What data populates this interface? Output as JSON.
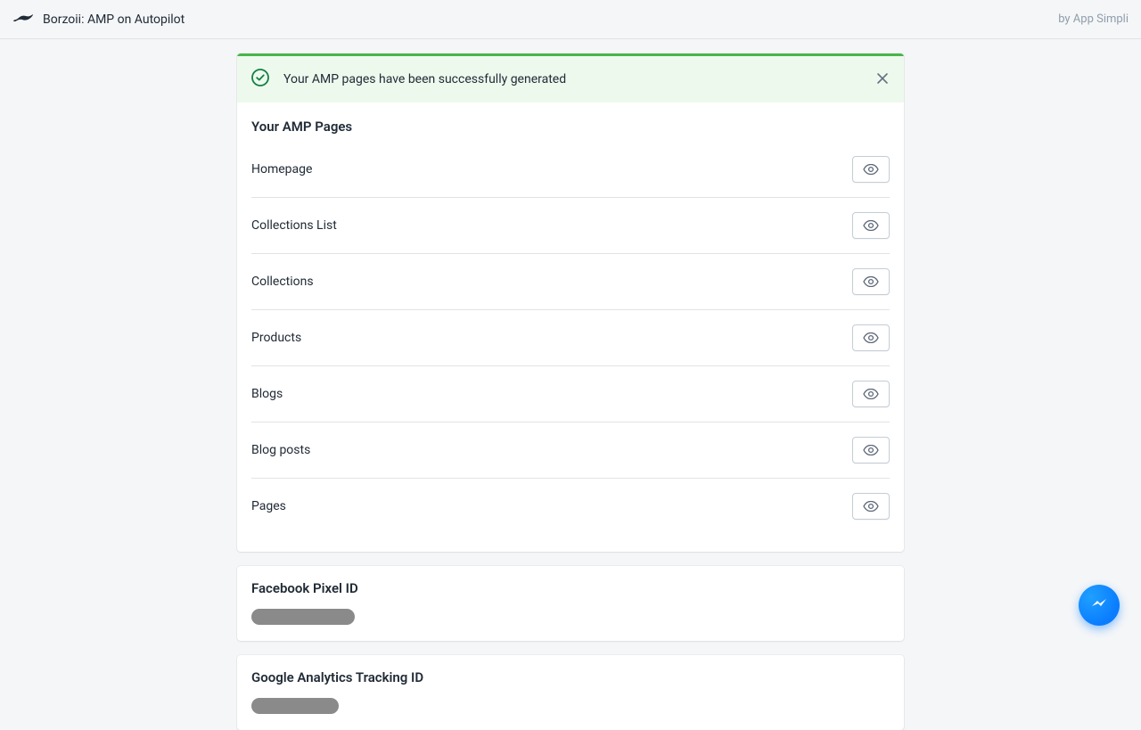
{
  "topbar": {
    "app_title": "Borzoii: AMP on Autopilot",
    "by_company": "by App Simpli"
  },
  "alert": {
    "message": "Your AMP pages have been successfully generated"
  },
  "main_card": {
    "title": "Your AMP Pages",
    "rows": [
      {
        "label": "Homepage"
      },
      {
        "label": "Collections List"
      },
      {
        "label": "Collections"
      },
      {
        "label": "Products"
      },
      {
        "label": "Blogs"
      },
      {
        "label": "Blog posts"
      },
      {
        "label": "Pages"
      }
    ]
  },
  "fb_card": {
    "title": "Facebook Pixel ID"
  },
  "ga_card": {
    "title": "Google Analytics Tracking ID"
  }
}
